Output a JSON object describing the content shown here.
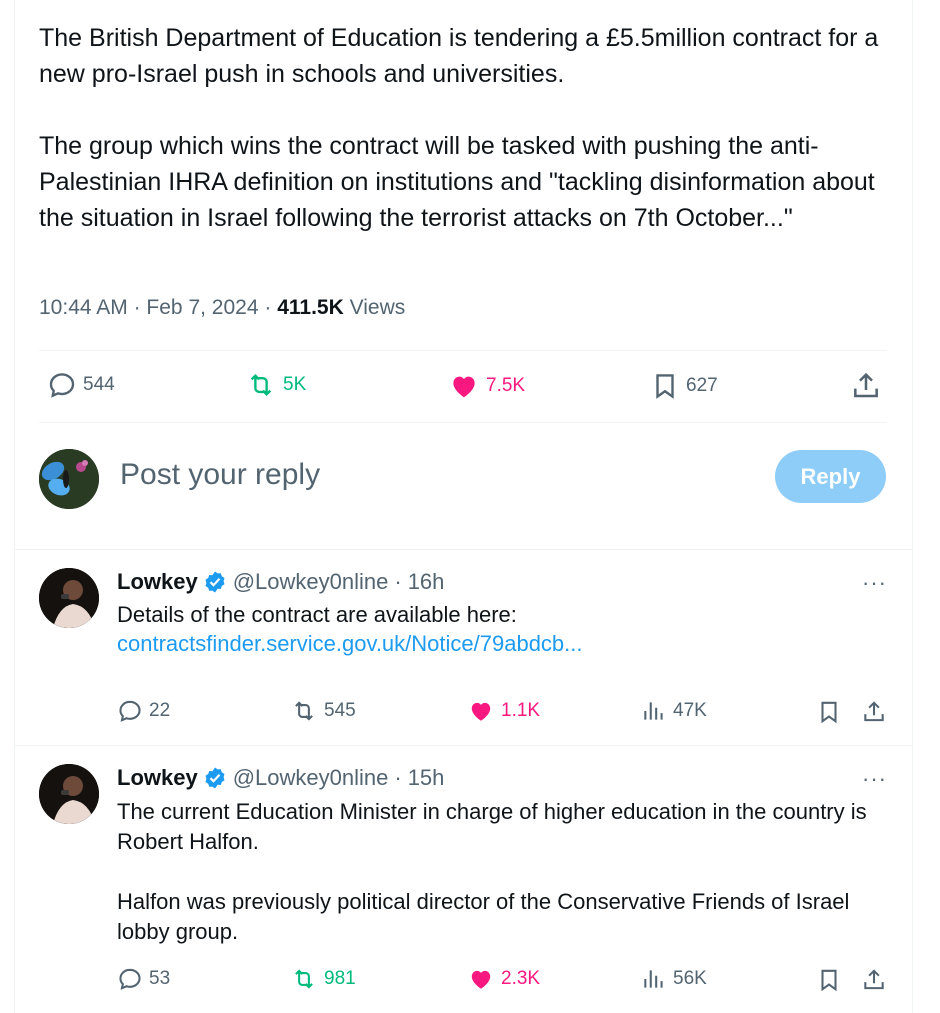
{
  "main_tweet": {
    "text": "The British Department of Education is tendering a £5.5million contract for a new pro-Israel push in schools and universities.\n\nThe group which wins the contract will be tasked with pushing the anti-Palestinian IHRA definition on institutions and \"tackling disinformation about the situation in Israel following the terrorist attacks on 7th October...\"",
    "time": "10:44 AM",
    "date": "Feb 7, 2024",
    "views_count": "411.5K",
    "views_label": "Views",
    "separator": "·",
    "replies": "544",
    "reposts": "5K",
    "likes": "7.5K",
    "bookmarks": "627"
  },
  "composer": {
    "placeholder": "Post your reply",
    "button_label": "Reply"
  },
  "replies": [
    {
      "name": "Lowkey",
      "handle": "@Lowkey0nline",
      "time": "16h",
      "text": "Details of the contract are available here:",
      "link": "contractsfinder.service.gov.uk/Notice/79abdcb...",
      "replies": "22",
      "reposts": "545",
      "likes": "1.1K",
      "views": "47K"
    },
    {
      "name": "Lowkey",
      "handle": "@Lowkey0nline",
      "time": "15h",
      "text": "The current Education Minister in charge of higher education in the country is Robert Halfon.\n\nHalfon was previously political director of the Conservative Friends of Israel lobby group.",
      "replies": "53",
      "reposts": "981",
      "likes": "2.3K",
      "views": "56K"
    }
  ],
  "more_label": "···",
  "dot": "·",
  "colors": {
    "accent": "#1d9bf0",
    "repost": "#00ba7c",
    "like": "#f91880",
    "muted": "#536471",
    "reply_button": "#8ecdf8"
  },
  "icons": [
    "reply-icon",
    "repost-icon",
    "heart-icon",
    "bookmark-icon",
    "share-icon",
    "views-icon",
    "verified-badge-icon",
    "more-icon"
  ]
}
